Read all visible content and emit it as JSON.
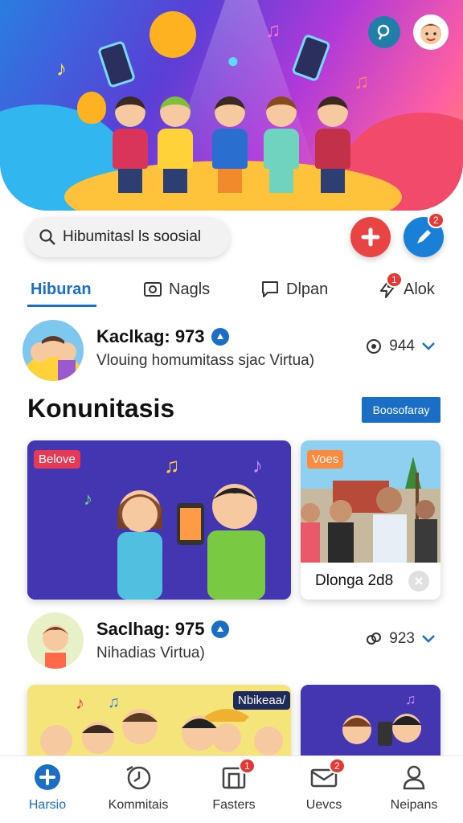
{
  "search": {
    "text": "Hibumitasl ls soosial"
  },
  "fabs": {
    "compose_badge": "2"
  },
  "tabs": [
    {
      "label": "Hiburan",
      "icon": "home-icon",
      "active": true
    },
    {
      "label": "Nagls",
      "icon": "camera-icon",
      "active": false
    },
    {
      "label": "Dlpan",
      "icon": "chat-icon",
      "active": false
    },
    {
      "label": "Alok",
      "icon": "bolt-icon",
      "active": false,
      "badge": "1"
    }
  ],
  "rows": [
    {
      "title": "Kaclkag: 973",
      "subtitle": "Vlouing homumitass sjac Virtua)",
      "stat": "944"
    },
    {
      "title": "Saclhag: 975",
      "subtitle": "Nihadias Virtua)",
      "stat": "923"
    }
  ],
  "section": {
    "title": "Konunitasis",
    "button": "Boosofaray"
  },
  "cards": [
    {
      "tag": "Belove",
      "tag_color": "#e53955"
    },
    {
      "tag": "Voes",
      "tag_color": "#ff8a3d",
      "caption": "Dlonga 2d8"
    }
  ],
  "bottom_cards": [
    {
      "tag": "Nbikeaa/"
    }
  ],
  "bottom_nav": [
    {
      "label": "Harsio",
      "icon": "plus-circle-icon",
      "active": true
    },
    {
      "label": "Kommitais",
      "icon": "clock-icon",
      "active": false
    },
    {
      "label": "Fasters",
      "icon": "square-icon",
      "active": false,
      "badge": "1"
    },
    {
      "label": "Uevcs",
      "icon": "mail-icon",
      "active": false,
      "badge": "2"
    },
    {
      "label": "Neipans",
      "icon": "person-icon",
      "active": false
    }
  ],
  "colors": {
    "accent": "#1a6fc4",
    "red": "#e53935"
  }
}
